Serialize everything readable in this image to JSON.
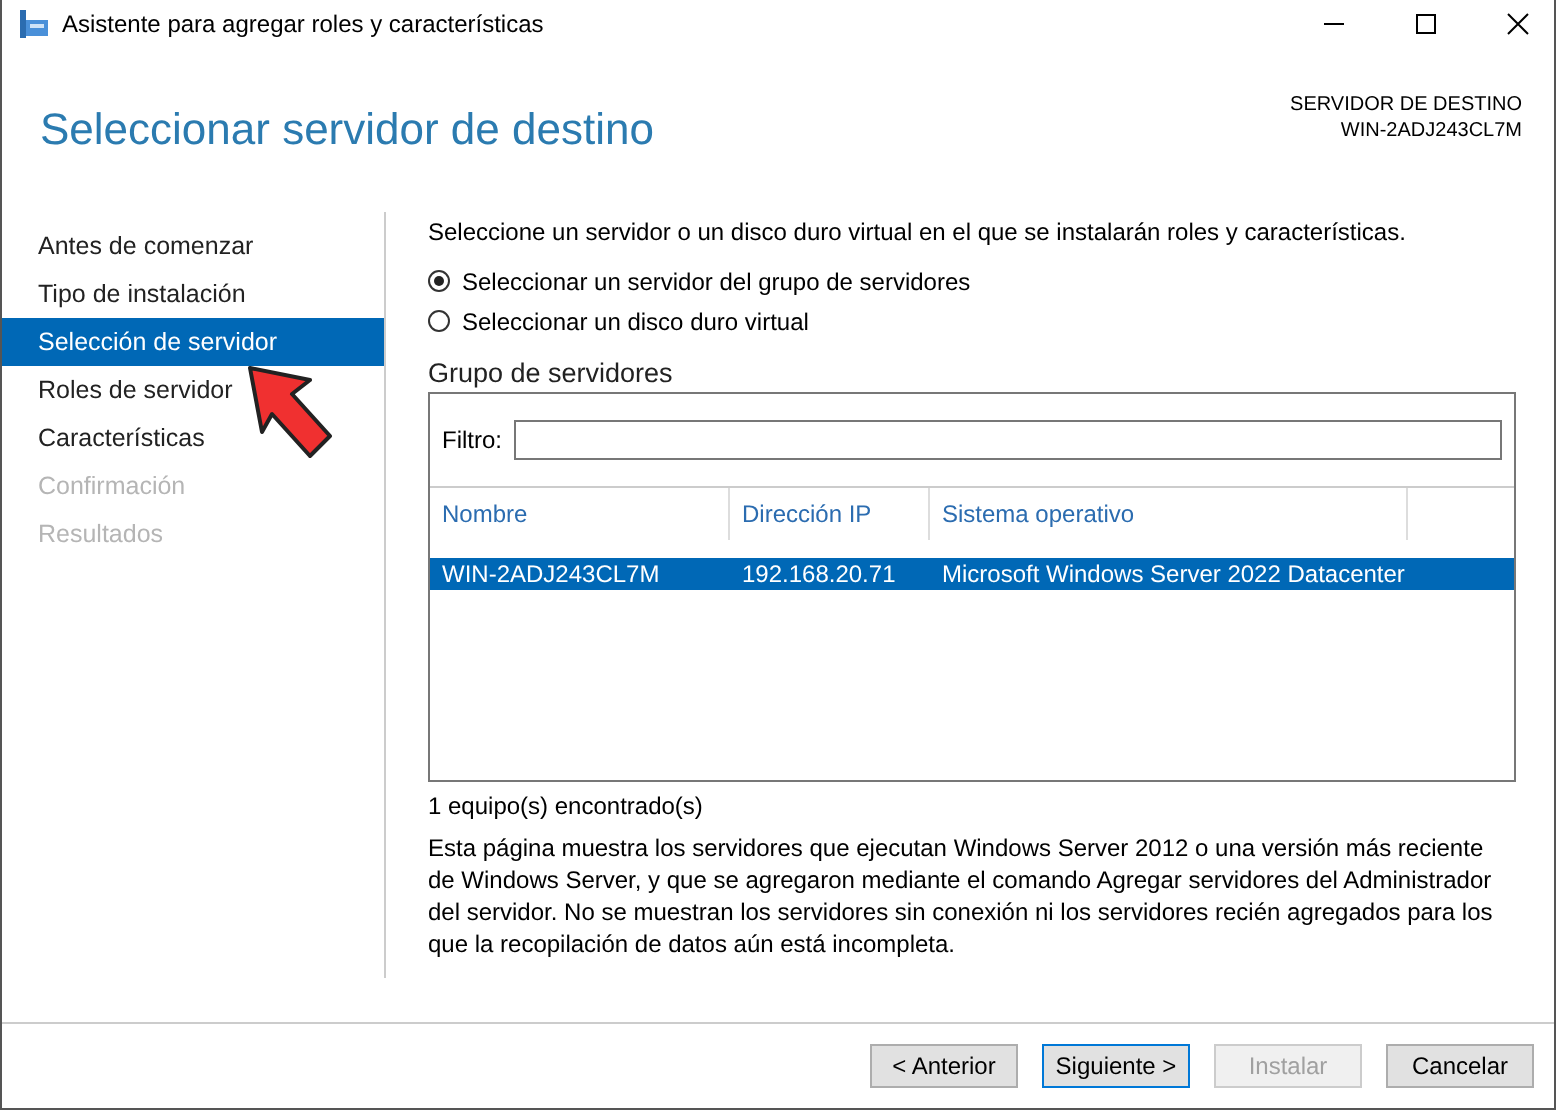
{
  "window": {
    "title": "Asistente para agregar roles y características"
  },
  "header": {
    "title": "Seleccionar servidor de destino",
    "destination_label": "SERVIDOR DE DESTINO",
    "destination_value": "WIN-2ADJ243CL7M"
  },
  "sidebar": {
    "items": [
      {
        "label": "Antes de comenzar",
        "selected": false,
        "disabled": false
      },
      {
        "label": "Tipo de instalación",
        "selected": false,
        "disabled": false
      },
      {
        "label": "Selección de servidor",
        "selected": true,
        "disabled": false
      },
      {
        "label": "Roles de servidor",
        "selected": false,
        "disabled": false
      },
      {
        "label": "Características",
        "selected": false,
        "disabled": false
      },
      {
        "label": "Confirmación",
        "selected": false,
        "disabled": true
      },
      {
        "label": "Resultados",
        "selected": false,
        "disabled": true
      }
    ]
  },
  "content": {
    "intro": "Seleccione un servidor o un disco duro virtual en el que se instalarán roles y características.",
    "options": [
      {
        "label": "Seleccionar un servidor del grupo de servidores",
        "selected": true
      },
      {
        "label": "Seleccionar un disco duro virtual",
        "selected": false
      }
    ],
    "group_title": "Grupo de servidores",
    "filter_label": "Filtro:",
    "table": {
      "columns": [
        "Nombre",
        "Dirección IP",
        "Sistema operativo"
      ],
      "rows": [
        {
          "cells": [
            "WIN-2ADJ243CL7M",
            "192.168.20.71",
            "Microsoft Windows Server 2022 Datacenter"
          ],
          "selected": true
        }
      ]
    },
    "count": "1 equipo(s) encontrado(s)",
    "description": "Esta página muestra los servidores que ejecutan Windows Server 2012 o una versión más reciente de Windows Server, y que se agregaron mediante el comando Agregar servidores del Administrador del servidor. No se muestran los servidores sin conexión ni los servidores recién agregados para los que la recopilación de datos aún está incompleta."
  },
  "buttons": [
    {
      "label": "< Anterior",
      "disabled": false,
      "default": false
    },
    {
      "label": "Siguiente >",
      "disabled": false,
      "default": true
    },
    {
      "label": "Instalar",
      "disabled": true,
      "default": false
    },
    {
      "label": "Cancelar",
      "disabled": false,
      "default": false
    }
  ]
}
